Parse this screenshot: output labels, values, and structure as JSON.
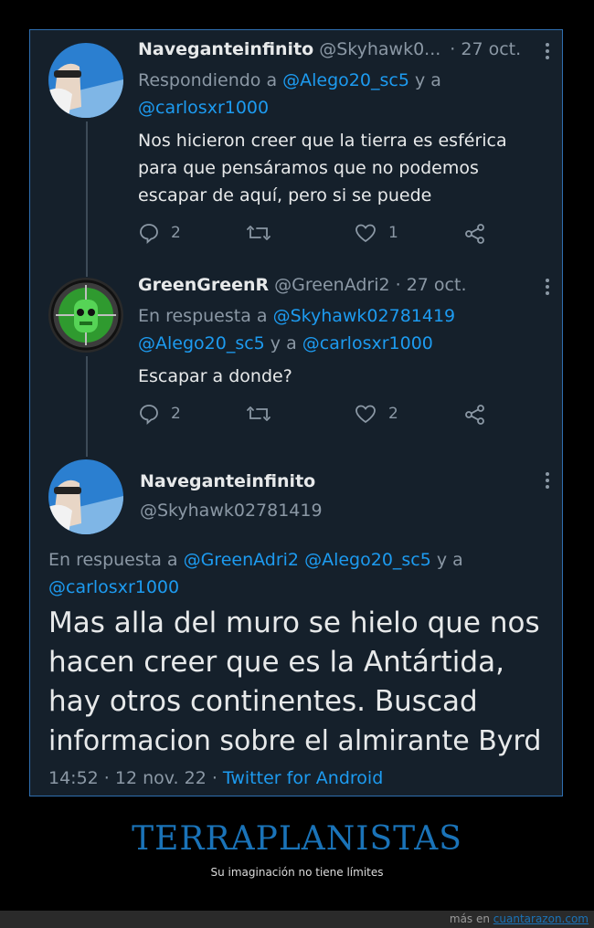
{
  "tweets": [
    {
      "name": "Naveganteinfinito",
      "handle": "@Skyhawk0...",
      "date": "· 27 oct.",
      "reply_prefix": "Respondiendo a ",
      "reply_user1": "@Alego20_sc5",
      "reply_join": " y a",
      "reply_user2": "@carlosxr1000",
      "text_lines": [
        "Nos hicieron creer que la tierra es esférica",
        "para que pensáramos que no podemos",
        "escapar de aquí, pero si se puede"
      ],
      "replies": "2",
      "retweets": "",
      "likes": "1"
    },
    {
      "name": "GreenGreenR",
      "handle": "@GreenAdri2",
      "date": "· 27 oct.",
      "reply_prefix": "En respuesta a ",
      "reply_user1": "@Skyhawk02781419",
      "reply_user2": "@Alego20_sc5",
      "reply_join": " y a ",
      "reply_user3": "@carlosxr1000",
      "text_lines": [
        "Escapar a donde?"
      ],
      "replies": "2",
      "retweets": "",
      "likes": "2"
    }
  ],
  "main_tweet": {
    "name": "Naveganteinfinito",
    "handle": "@Skyhawk02781419",
    "reply_prefix": "En respuesta a ",
    "reply_user1": "@GreenAdri2",
    "reply_user2": "@Alego20_sc5",
    "reply_join": " y a",
    "reply_user3": "@carlosxr1000",
    "text_lines": [
      "Mas alla del muro se hielo que nos",
      "hacen creer que es la Antártida,",
      "hay otros continentes. Buscad",
      "informacion sobre el almirante Byrd"
    ],
    "time": "14:52 · 12 nov. 22 · ",
    "source": "Twitter for Android"
  },
  "caption": {
    "title": "TERRAPLANISTAS",
    "subtitle": "Su imaginación no tiene límites"
  },
  "footer": {
    "prefix": "más en ",
    "site": "cuantarazon.com"
  },
  "colors": {
    "background": "#15202b",
    "accent": "#1d9bf0",
    "muted": "#8b98a5",
    "caption_blue": "#1a73b8"
  }
}
